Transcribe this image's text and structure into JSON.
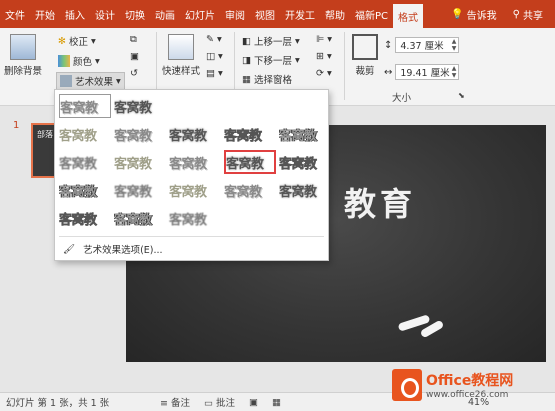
{
  "tabs": [
    "文件",
    "开始",
    "插入",
    "设计",
    "切换",
    "动画",
    "幻灯片",
    "审阅",
    "视图",
    "开发工",
    "帮助",
    "福新PC",
    "格式"
  ],
  "active_tab": "格式",
  "tab_right": {
    "tell_me": "告诉我",
    "share": "共享"
  },
  "ribbon": {
    "remove_bg": "删除背景",
    "correct": "校正",
    "color": "颜色",
    "art_effect": "艺术效果",
    "quick_style": "快速样式",
    "bring_forward": "上移一层",
    "send_backward": "下移一层",
    "selection_pane": "选择窗格",
    "crop": "裁剪",
    "height": "4.37 厘米",
    "width": "19.41 厘米",
    "size_group": "大小"
  },
  "thumbnail": {
    "number": "1",
    "text": "部落"
  },
  "dropdown": {
    "rows": [
      [
        "客窝教",
        "客窝教"
      ],
      [
        "客窝教",
        "客窝教",
        "客窝教",
        "客窝教",
        "客窝教"
      ],
      [
        "客窝教",
        "客窝教",
        "客窝教",
        "客窝教",
        "客窝教"
      ],
      [
        "客窝教",
        "客窝教",
        "客窝教",
        "客窝教",
        "客窝教"
      ],
      [
        "客窝教",
        "客窝教",
        "客窝教"
      ]
    ],
    "options_label": "艺术效果选项(E)..."
  },
  "slide": {
    "title": "教育"
  },
  "status": {
    "slide_info": "幻灯片 第 1 张，共 1 张",
    "notes": "备注",
    "comments": "批注",
    "zoom": "41%"
  },
  "watermark": {
    "brand": "Office教程网",
    "url": "www.office26.com"
  },
  "colors": {
    "accent": "#c43e1c",
    "highlight": "#e04040",
    "brand": "#e8541e"
  }
}
